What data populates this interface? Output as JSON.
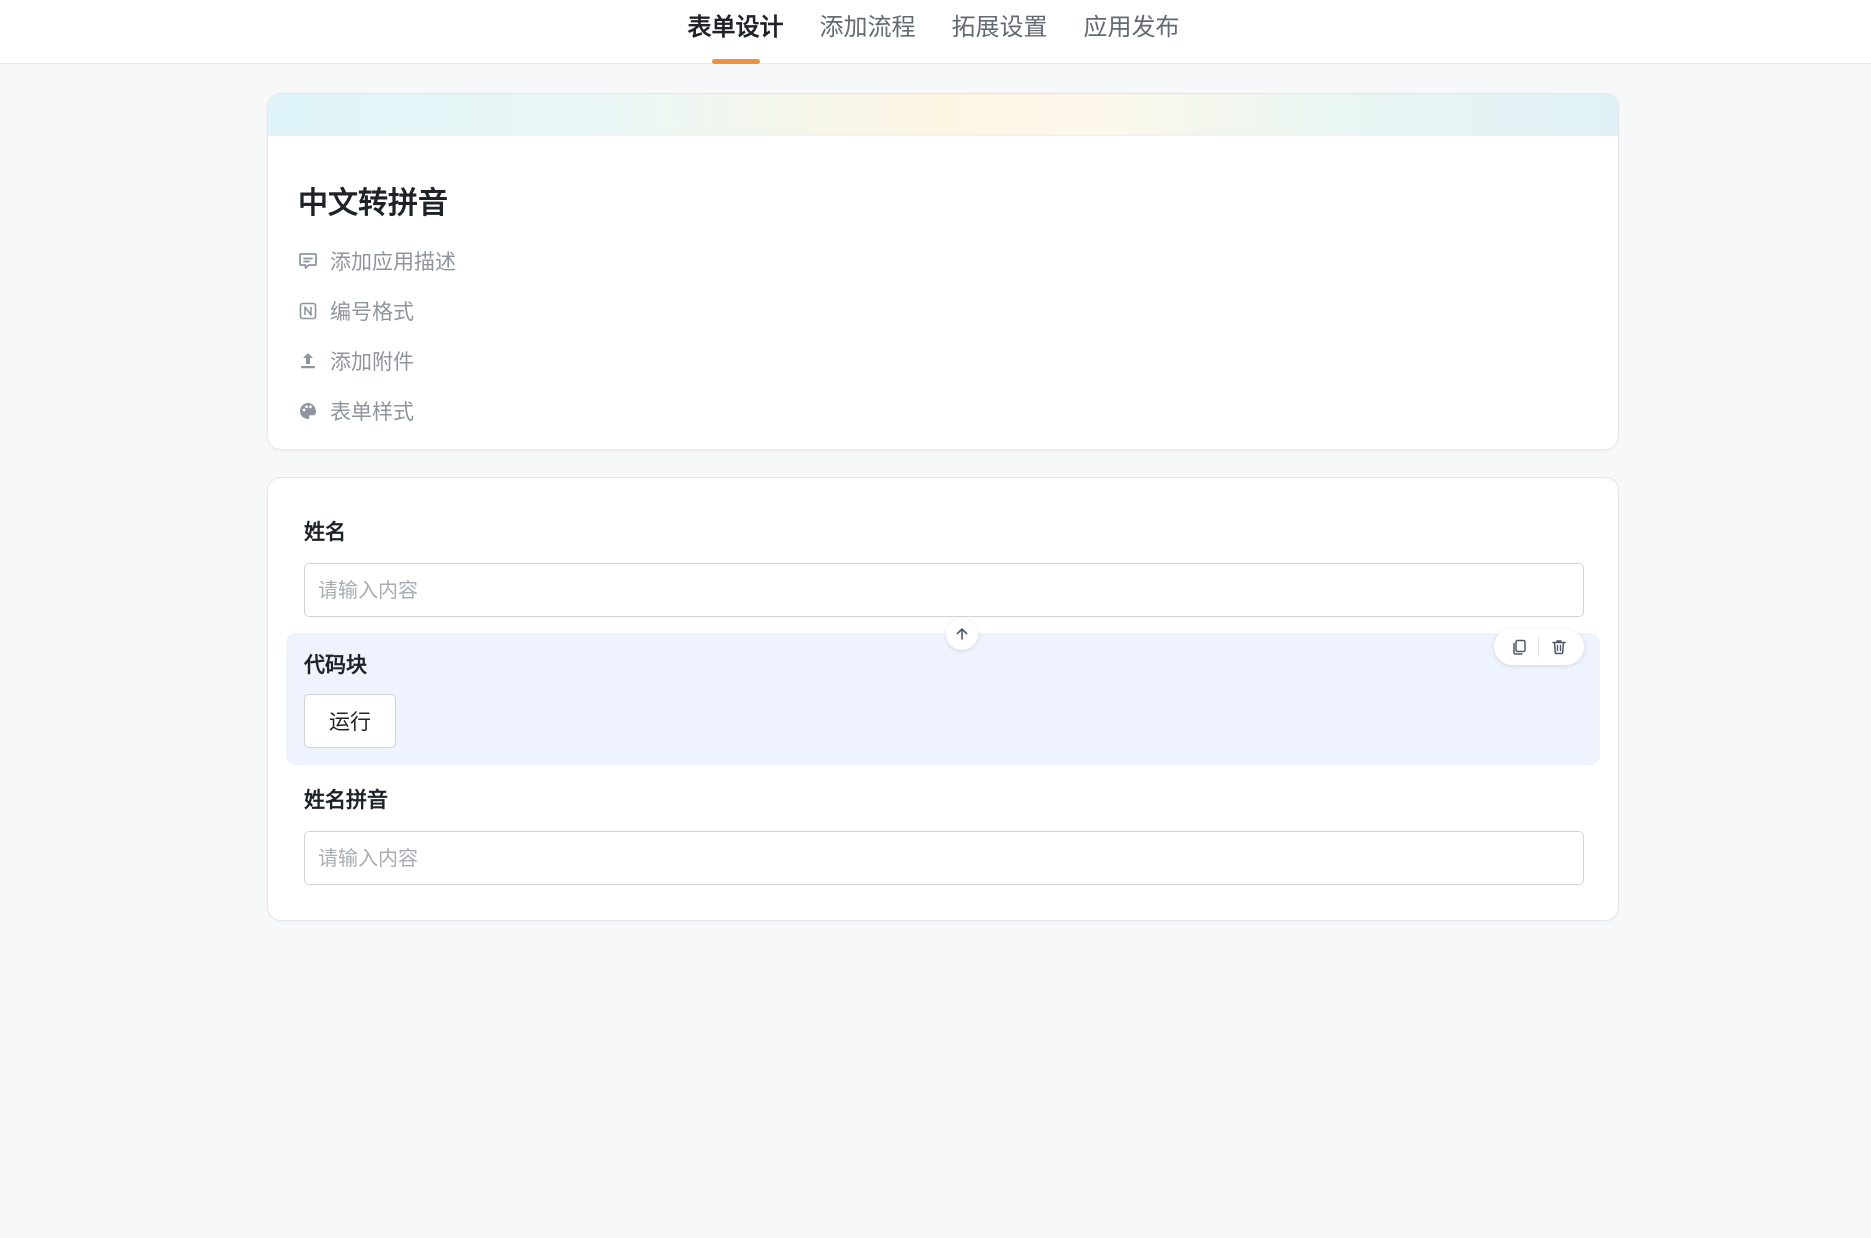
{
  "theme": {
    "accent": "#f0913f"
  },
  "tabs": [
    {
      "label": "表单设计",
      "active": true
    },
    {
      "label": "添加流程",
      "active": false
    },
    {
      "label": "拓展设置",
      "active": false
    },
    {
      "label": "应用发布",
      "active": false
    }
  ],
  "app": {
    "title": "中文转拼音",
    "meta": [
      {
        "label": "添加应用描述",
        "icon": "comment-icon"
      },
      {
        "label": "编号格式",
        "icon": "number-format-icon"
      },
      {
        "label": "添加附件",
        "icon": "upload-icon"
      },
      {
        "label": "表单样式",
        "icon": "palette-icon"
      }
    ]
  },
  "form": {
    "fields": [
      {
        "label": "姓名",
        "placeholder": "请输入内容",
        "value": ""
      },
      {
        "label": "姓名拼音",
        "placeholder": "请输入内容",
        "value": ""
      }
    ],
    "code_block": {
      "label": "代码块",
      "run_label": "运行",
      "icons": [
        "arrow-up-icon",
        "copy-icon",
        "trash-icon"
      ]
    }
  }
}
